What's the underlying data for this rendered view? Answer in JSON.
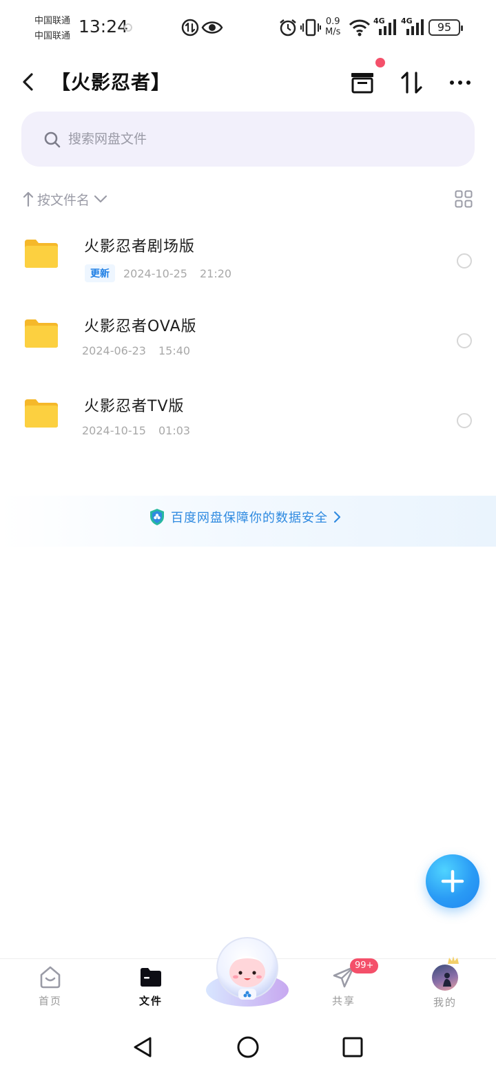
{
  "status_bar": {
    "carrier_1": "中国联通",
    "carrier_2": "中国联通",
    "time": "13:24",
    "net_speed_value": "0.9",
    "net_speed_unit": "M/s",
    "network_1": "4G",
    "network_2": "4G",
    "battery": "95"
  },
  "header": {
    "title": "【火影忍者】"
  },
  "search": {
    "placeholder": "搜索网盘文件"
  },
  "sort": {
    "label": "按文件名"
  },
  "files": [
    {
      "name": "火影忍者剧场版",
      "badge": "更新",
      "date": "2024-10-25",
      "time": "21:20"
    },
    {
      "name": "火影忍者OVA版",
      "badge": "",
      "date": "2024-06-23",
      "time": "15:40"
    },
    {
      "name": "火影忍者TV版",
      "badge": "",
      "date": "2024-10-15",
      "time": "01:03"
    }
  ],
  "security_banner": {
    "text": "百度网盘保障你的数据安全"
  },
  "bottom_nav": {
    "home": "首页",
    "files": "文件",
    "share": "共享",
    "mine": "我的",
    "share_badge": "99+"
  },
  "colors": {
    "accent": "#2a9bf5",
    "badge_red": "#f4506a",
    "folder_yellow": "#fcc93a",
    "search_bg": "#f2f0fb"
  },
  "icons": {
    "back": "chevron-left-icon",
    "archive": "archive-box-icon",
    "sort": "sort-arrows-icon",
    "more": "more-dots-icon",
    "search": "search-icon",
    "grid": "grid-view-icon",
    "folder": "folder-icon",
    "fab": "plus-icon"
  }
}
